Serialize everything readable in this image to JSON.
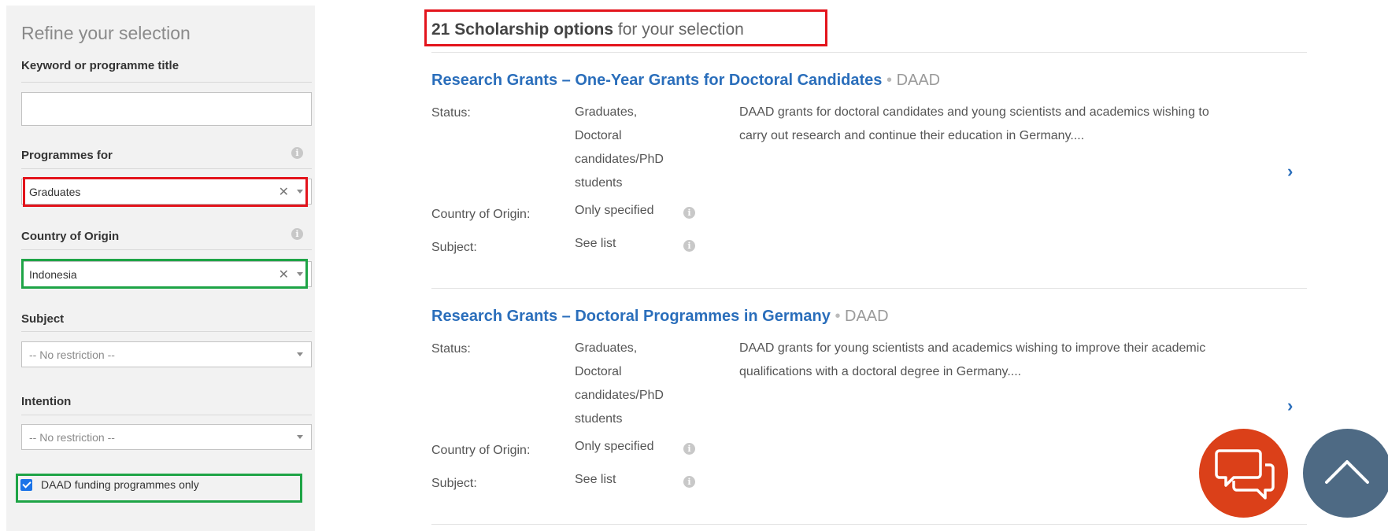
{
  "sidebar": {
    "title": "Refine your selection",
    "keyword": {
      "label": "Keyword or programme title",
      "value": ""
    },
    "programmes_for": {
      "label": "Programmes for",
      "value": "Graduates"
    },
    "country_of_origin": {
      "label": "Country of Origin",
      "value": "Indonesia"
    },
    "subject": {
      "label": "Subject",
      "placeholder": "-- No restriction --"
    },
    "intention": {
      "label": "Intention",
      "placeholder": "-- No restriction --"
    },
    "daad_only": {
      "label": "DAAD funding programmes only",
      "checked": true
    }
  },
  "results": {
    "count": "21 Scholarship options",
    "suffix": "for your selection",
    "items": [
      {
        "title": "Research Grants – One-Year Grants for Doctoral Candidates",
        "sep": "•",
        "org": "DAAD",
        "status_label": "Status:",
        "status_lines": [
          "Graduates,",
          "Doctoral",
          "candidates/PhD",
          "students"
        ],
        "country_label": "Country of Origin:",
        "country_value": "Only specified",
        "subject_label": "Subject:",
        "subject_value": "See list",
        "description": "DAAD grants for doctoral candidates and young scientists and academics wishing to carry out research and continue their education in Germany...."
      },
      {
        "title": "Research Grants – Doctoral Programmes in Germany",
        "sep": "•",
        "org": "DAAD",
        "status_label": "Status:",
        "status_lines": [
          "Graduates,",
          "Doctoral",
          "candidates/PhD",
          "students"
        ],
        "country_label": "Country of Origin:",
        "country_value": "Only specified",
        "subject_label": "Subject:",
        "subject_value": "See list",
        "description": "DAAD grants for young scientists and academics wishing to improve their academic qualifications with a doctoral degree in Germany...."
      }
    ]
  },
  "icons": {
    "info": "info-circle-icon",
    "clear": "✕",
    "chevron": "›",
    "chat": "chat-bubbles-icon",
    "back_to_top": "chevron-up-icon"
  },
  "colors": {
    "highlight_red": "#e3141c",
    "highlight_green": "#1ea446",
    "link_blue": "#2a6ebb",
    "chat_orange": "#db4019",
    "top_slate": "#4e6a84"
  }
}
